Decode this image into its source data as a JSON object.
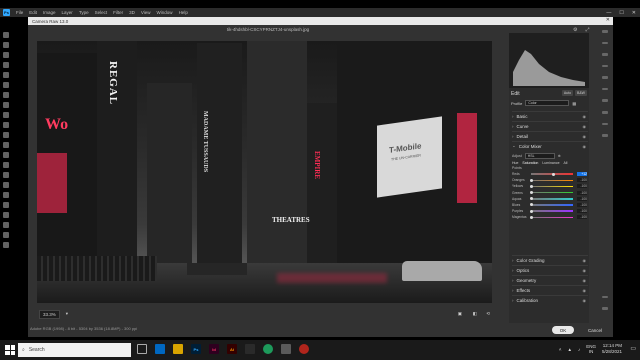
{
  "app": {
    "menu": [
      "File",
      "Edit",
      "Image",
      "Layer",
      "Type",
      "Select",
      "Filter",
      "3D",
      "View",
      "Window",
      "Help"
    ],
    "logo": "Ps"
  },
  "camera_raw": {
    "title": "Camera Raw 13.0",
    "filename": "tik-4hdshbl-CSCYPRNZTJ4-unsplash.jpg",
    "zoom": "33.3%",
    "file_footer": "Adobe RGB (1998) - 8 bit - 5304 by 3536 (18.8MP) - 300 ppi",
    "ok_label": "OK",
    "cancel_label": "Cancel",
    "edit_label": "Edit",
    "auto_label": "Auto",
    "bw_label": "B&W",
    "profile_label": "Profile",
    "profile_value": "Color",
    "sections_top": [
      "Basic",
      "Curve",
      "Detail"
    ],
    "color_mixer": {
      "title": "Color Mixer",
      "adjust_label": "Adjust",
      "adjust_value": "HSL",
      "tabs": [
        "Hue",
        "Saturation",
        "Luminance",
        "All"
      ],
      "active_tab": "Saturation",
      "points_label": "Points",
      "rows": [
        {
          "label": "Reds",
          "value": "+12",
          "pos": 0.56
        },
        {
          "label": "Oranges",
          "value": "-100",
          "pos": 0.0
        },
        {
          "label": "Yellows",
          "value": "-100",
          "pos": 0.0
        },
        {
          "label": "Greens",
          "value": "-100",
          "pos": 0.0
        },
        {
          "label": "Aquas",
          "value": "-100",
          "pos": 0.0
        },
        {
          "label": "Blues",
          "value": "-100",
          "pos": 0.0
        },
        {
          "label": "Purples",
          "value": "-100",
          "pos": 0.0
        },
        {
          "label": "Magentas",
          "value": "-100",
          "pos": 0.0
        }
      ]
    },
    "sections_bottom": [
      "Color Grading",
      "Optics",
      "Geometry",
      "Effects",
      "Calibration"
    ]
  },
  "photo": {
    "signs": [
      "REGAL",
      "T-Mobile",
      "THE UN-CARRIER",
      "EMPIRE",
      "THEATRES",
      "MADAME TUSSAUDS"
    ]
  },
  "taskbar": {
    "search_placeholder": "Search",
    "lang": "ENG",
    "locale": "IN",
    "time": "12:14 PM",
    "date": "5/28/2021"
  },
  "colors": {
    "panel_bg": "#2c2c2c",
    "window_bg": "#323232",
    "accent_blue": "#1473e6",
    "sign_red": "#d7284a"
  }
}
